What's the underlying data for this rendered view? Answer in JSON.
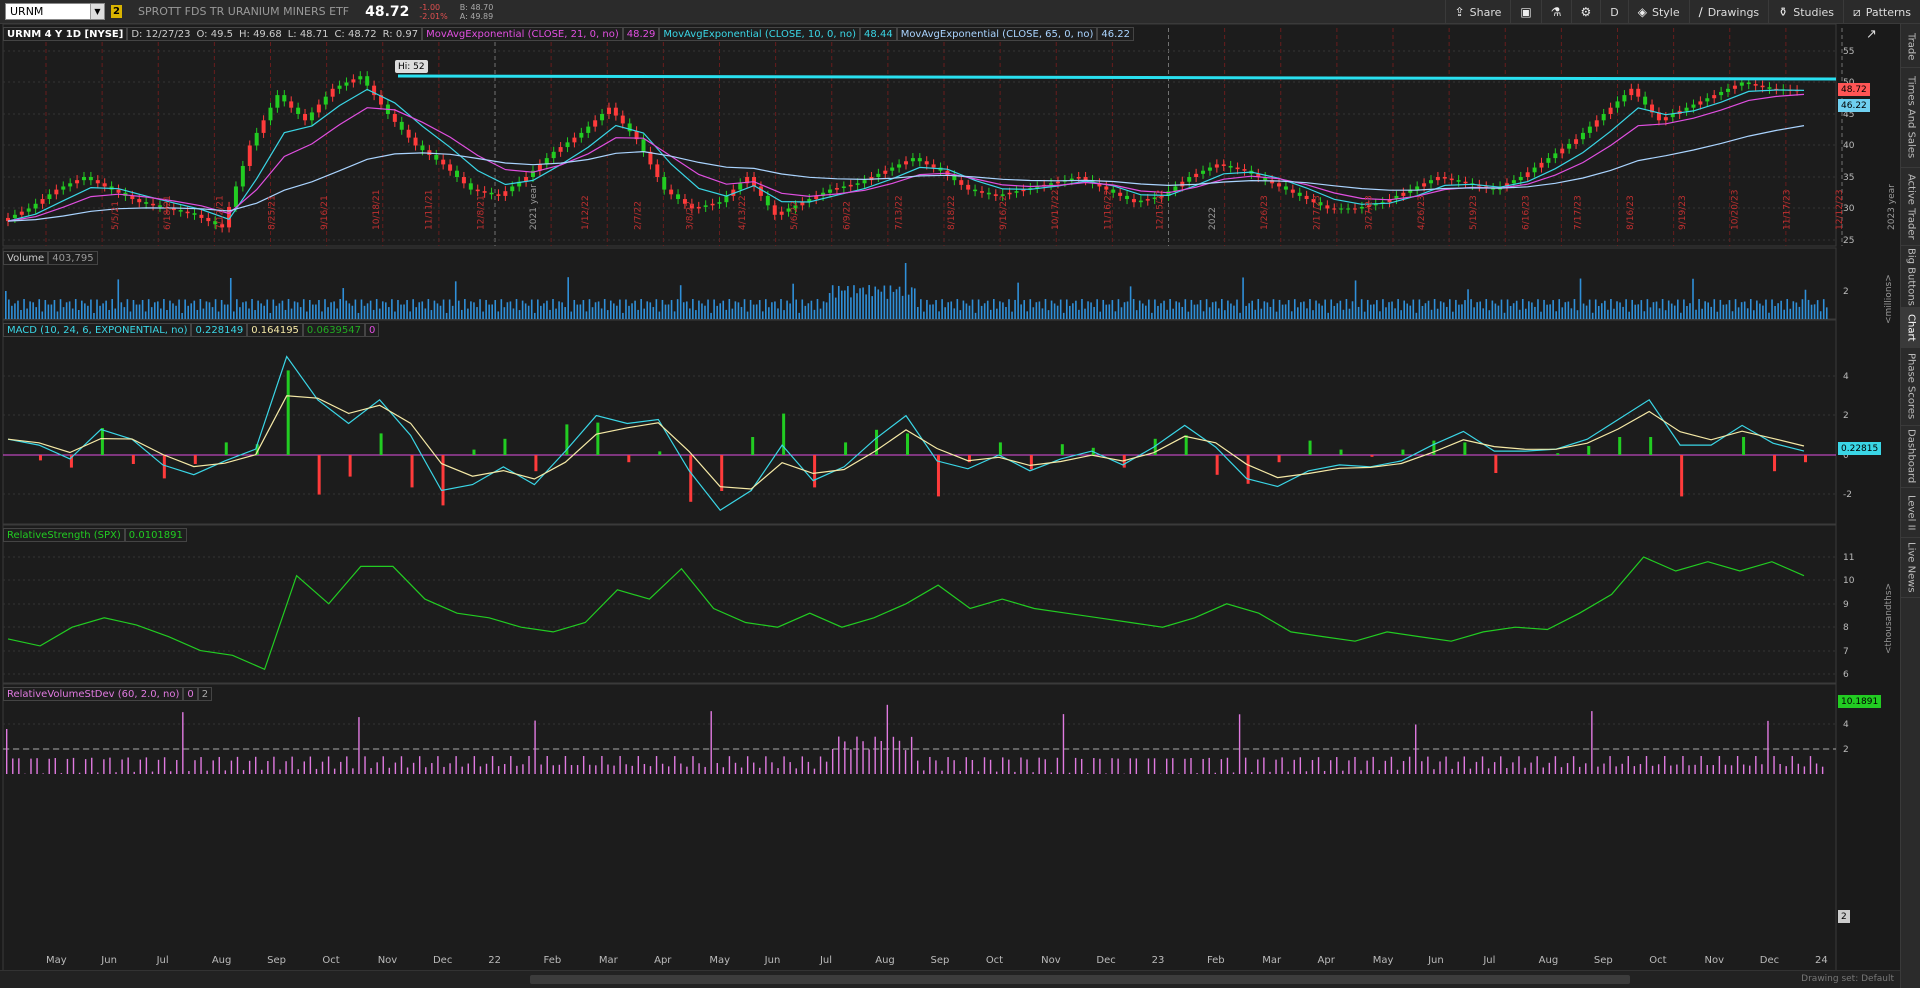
{
  "toolbar": {
    "symbol": "URNM",
    "link_badge": "2",
    "description": "SPROTT FDS TR URANIUM MINERS ETF",
    "last_price": "48.72",
    "change": "-1.00",
    "change_pct": "-2.01%",
    "bid": "B: 48.70",
    "ask": "A: 49.89",
    "buttons": [
      "Share",
      "",
      "",
      "",
      "D",
      "Style",
      "Drawings",
      "Studies",
      "Patterns"
    ]
  },
  "side_tabs": [
    "Trade",
    "Times And Sales",
    "Active Trader",
    "Big Buttons",
    "Chart",
    "Phase Scores",
    "Dashboard",
    "Level II",
    "Live News"
  ],
  "price_panel": {
    "title": "URNM 4 Y 1D [NYSE]",
    "ohlc": "D: 12/27/23",
    "open": "O: 49.5",
    "high": "H: 49.68",
    "low": "L: 48.71",
    "close": "C: 48.72",
    "range": "R: 0.97",
    "studies": [
      {
        "label": "MovAvgExponential (CLOSE, 21, 0, no)",
        "value": "48.29",
        "color": "#e04fe0"
      },
      {
        "label": "MovAvgExponential (CLOSE, 10, 0, no)",
        "value": "48.44",
        "color": "#3ad6e6"
      },
      {
        "label": "MovAvgExponential (CLOSE, 65, 0, no)",
        "value": "46.22",
        "color": "#aad4ff"
      }
    ],
    "hi_bubble": "Hi: 52",
    "last_tag": "48.72",
    "ema65_tag": "46.22",
    "y_ticks": [
      "55",
      "50",
      "45",
      "40",
      "35",
      "30",
      "25"
    ],
    "date_marks": [
      "5/5/21",
      "6/18/21",
      "7/12/21",
      "8/25/21",
      "9/16/21",
      "10/18/21",
      "11/11/21",
      "12/8/21",
      "2021 year",
      "1/12/22",
      "2/7/22",
      "3/8/22",
      "4/13/22",
      "5/6/22",
      "6/9/22",
      "7/13/22",
      "8/18/22",
      "9/16/22",
      "10/17/22",
      "11/16/22",
      "12/15/22",
      "2022",
      "1/26/23",
      "2/17/23",
      "3/27/23",
      "4/26/23",
      "5/19/23",
      "6/16/23",
      "7/17/23",
      "8/16/23",
      "9/19/23",
      "10/20/23",
      "11/17/23",
      "12/12/23",
      "2023 year"
    ]
  },
  "volume_panel": {
    "label": "Volume",
    "value": "403,795",
    "y_ticks": [
      "2"
    ],
    "unit": "<millions>"
  },
  "macd_panel": {
    "label": "MACD (10, 24, 6, EXPONENTIAL, no)",
    "value": "0.228149",
    "avg": "0.164195",
    "diff": "0.0639547",
    "zero": "0",
    "tag": "0.22815",
    "y_ticks": [
      "4",
      "2",
      "0",
      "-2"
    ]
  },
  "rs_panel": {
    "label": "RelativeStrength (SPX)",
    "value": "0.0101891",
    "tag": "10.1891",
    "y_ticks": [
      "11",
      "10",
      "9",
      "8",
      "7",
      "6"
    ],
    "unit": "<thousandths>"
  },
  "rvsd_panel": {
    "label": "RelativeVolumeStDev (60, 2.0, no)",
    "value": "0",
    "dev": "2",
    "tag": "2",
    "y_ticks": [
      "4",
      "2"
    ]
  },
  "x_axis": [
    "May",
    "Jun",
    "Jul",
    "Aug",
    "Sep",
    "Oct",
    "Nov",
    "Dec",
    "22",
    "Feb",
    "Mar",
    "Apr",
    "May",
    "Jun",
    "Jul",
    "Aug",
    "Sep",
    "Oct",
    "Nov",
    "Dec",
    "23",
    "Feb",
    "Mar",
    "Apr",
    "May",
    "Jun",
    "Jul",
    "Aug",
    "Sep",
    "Oct",
    "Nov",
    "Dec",
    "24"
  ],
  "status": {
    "drawing_set": "Drawing set: Default"
  },
  "colors": {
    "up": "#22cc22",
    "down": "#ff3b3b",
    "ema21": "#e04fe0",
    "ema10": "#3ad6e6",
    "ema65": "#aad4ff",
    "resistance": "#29e0f0",
    "volume": "#2f8fd8",
    "macd": "#3ad6e6",
    "macd_avg": "#f5e9a6",
    "rs": "#22cc22",
    "rvsd": "#e07ae0"
  }
}
